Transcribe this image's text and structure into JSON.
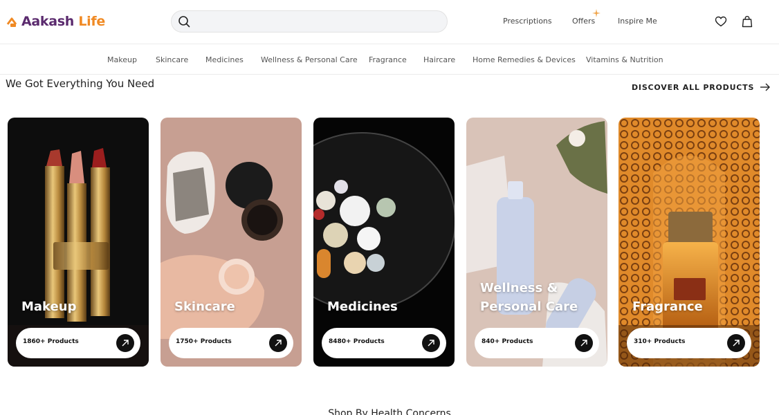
{
  "brand": {
    "name_part1": "Aakash",
    "name_part2": "Life",
    "primary_color": "#5b2b6e",
    "accent_color": "#f08a24"
  },
  "search": {
    "placeholder": ""
  },
  "header_links": {
    "prescriptions": "Prescriptions",
    "offers": "Offers",
    "inspire": "Inspire Me"
  },
  "header_icons": [
    "heart-icon",
    "shopping-bag-icon"
  ],
  "categories": [
    "Makeup",
    "Skincare",
    "Medicines",
    "Wellness & Personal Care",
    "Fragrance",
    "Haircare",
    "Home Remedies & Devices",
    "Vitamins & Nutrition"
  ],
  "section": {
    "title": "We Got Everything You Need",
    "discover_label": "DISCOVER ALL PRODUCTS"
  },
  "cards": [
    {
      "title": "Makeup",
      "count": "1860+ Products"
    },
    {
      "title": "Skincare",
      "count": "1750+ Products"
    },
    {
      "title": "Medicines",
      "count": "8480+ Products"
    },
    {
      "title": "Wellness & Personal Care",
      "count": "840+ Products"
    },
    {
      "title": "Fragrance",
      "count": "310+ Products"
    }
  ],
  "next_section": {
    "title": "Shop By Health Concerns"
  }
}
